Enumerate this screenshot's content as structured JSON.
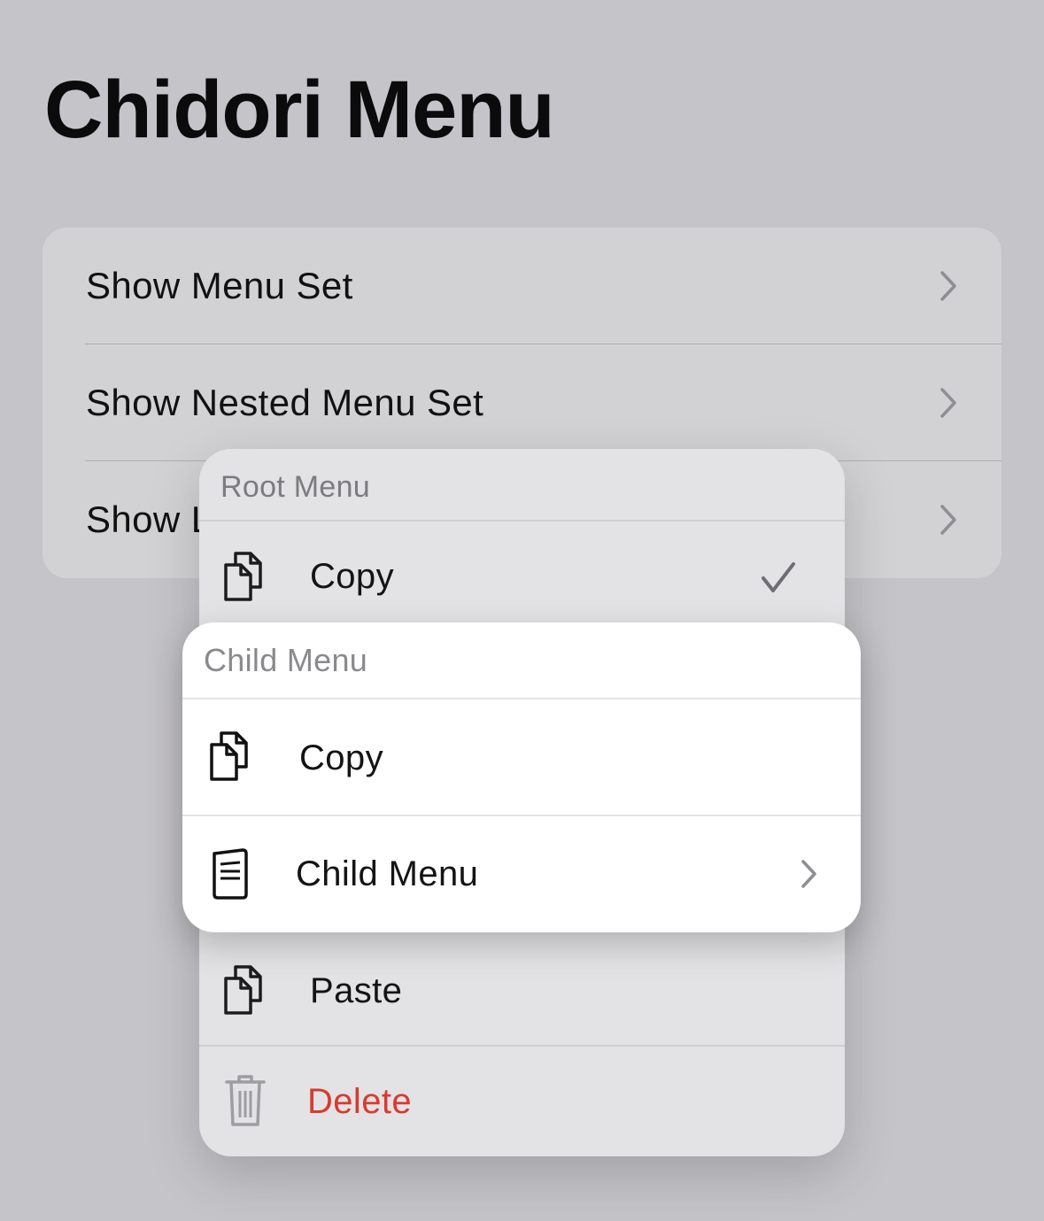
{
  "page": {
    "title": "Chidori Menu"
  },
  "list": {
    "rows": [
      {
        "label": "Show Menu Set"
      },
      {
        "label": "Show Nested Menu Set"
      },
      {
        "label": "Show L"
      }
    ]
  },
  "root_menu": {
    "header": "Root Menu",
    "items": [
      {
        "label": "Copy",
        "icon": "doc-on-doc-icon",
        "checked": true
      },
      {
        "label": "Paste",
        "icon": "doc-on-doc-icon"
      },
      {
        "label": "Delete",
        "icon": "trash-icon",
        "destructive": true,
        "color": "#d93a2f"
      }
    ]
  },
  "child_menu": {
    "header": "Child Menu",
    "items": [
      {
        "label": "Copy",
        "icon": "doc-on-doc-icon"
      },
      {
        "label": "Child Menu",
        "icon": "doc-text-icon",
        "has_submenu": true
      }
    ]
  }
}
